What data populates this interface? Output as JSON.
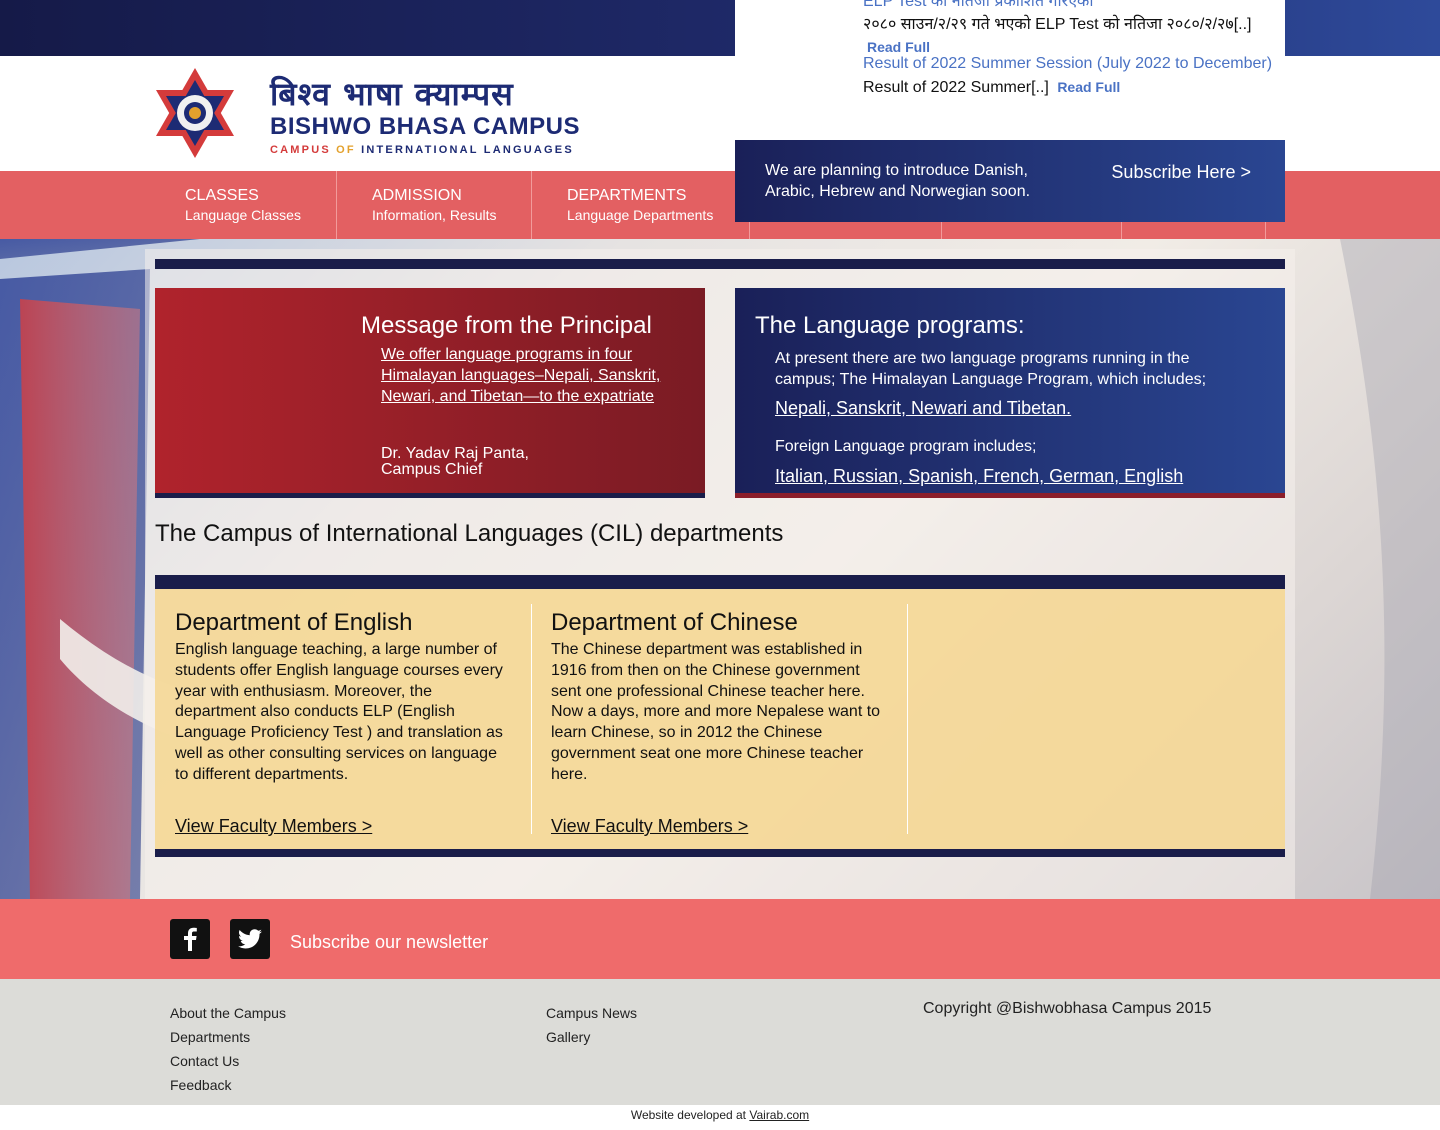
{
  "logo": {
    "devanagari": "बिश्व भाषा क्याम्पस",
    "english": "BISHWO BHASA CAMPUS",
    "sub_campus": "CAMPUS",
    "sub_of": "OF",
    "sub_intl": "INTERNATIONAL",
    "sub_lang": "LANGUAGES"
  },
  "news": [
    {
      "title": "ELP Test को नतिजा प्रकाशित गरिएको",
      "body": "२०८० साउन/२/२९ गते भएको  ELP Test को नतिजा  २०८०/२/२७[..]",
      "read": "Read Full"
    },
    {
      "title": "Result of 2022 Summer Session (July 2022 to December)",
      "body": "Result of 2022 Summer[..]",
      "read": "Read Full"
    }
  ],
  "subscribe": {
    "text": "We are planning to introduce Danish, Arabic, Hebrew and Norwegian soon.",
    "link": "Subscribe Here >"
  },
  "nav": [
    {
      "title": "CLASSES",
      "sub": "Language Classes"
    },
    {
      "title": "ADMISSION",
      "sub": "Information, Results"
    },
    {
      "title": "DEPARTMENTS",
      "sub": "Language Departments"
    },
    {
      "title": "",
      "sub": ""
    },
    {
      "title": "",
      "sub": ""
    },
    {
      "title": "",
      "sub": ""
    }
  ],
  "principal": {
    "heading": "Message from the Principal",
    "message": "We offer language programs in four Himalayan languages–Nepali, Sanskrit, Newari, and Tibetan—to the expatriate",
    "name": "Dr. Yadav Raj Panta,",
    "role": "Campus Chief"
  },
  "programs": {
    "heading": "The Language programs:",
    "intro": "At present there are two language programs running in the campus; The Himalayan Language Program, which includes;",
    "himalayan": "Nepali, Sanskrit, Newari and Tibetan.",
    "foreign_intro": "Foreign Language program includes;",
    "foreign": "Italian, Russian, Spanish, French, German, English"
  },
  "departments": {
    "heading": "The Campus of International Languages (CIL) departments",
    "items": [
      {
        "title": "Department of English",
        "text": "English language teaching, a large number of students offer English language courses every year with enthusiasm. Moreover, the department also conducts ELP (English Language Proficiency Test ) and translation as well as other consulting services on language to different departments.",
        "link": "View Faculty Members >"
      },
      {
        "title": "Department of Chinese",
        "text": "The Chinese department was established in 1916 from then on the Chinese government sent one professional Chinese teacher here. Now a days, more and more Nepalese want to learn Chinese, so in 2012 the Chinese government seat one more Chinese teacher here.",
        "link": "View Faculty Members >"
      }
    ]
  },
  "footer": {
    "newsletter": "Subscribe our newsletter",
    "links_col1": [
      "About the Campus",
      "Departments",
      "Contact Us",
      "Feedback"
    ],
    "links_col2": [
      "Campus News",
      "Gallery"
    ],
    "copyright": "Copyright @Bishwobhasa Campus 2015",
    "credit_prefix": "Website developed at ",
    "credit_link": "Vairab.com"
  }
}
